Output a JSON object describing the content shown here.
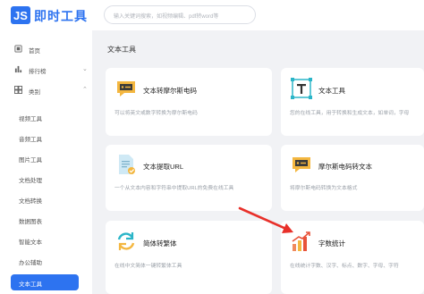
{
  "app": {
    "title": "即时工具"
  },
  "search": {
    "placeholder": "输入关键词搜索，如视频编辑、pdf转word等"
  },
  "sidebar": {
    "items": [
      {
        "label": "首页",
        "icon": "home-icon"
      },
      {
        "label": "排行榜",
        "icon": "ranking-icon"
      },
      {
        "label": "类别",
        "icon": "category-icon"
      },
      {
        "label": "视频工具"
      },
      {
        "label": "音频工具"
      },
      {
        "label": "图片工具"
      },
      {
        "label": "文档处理"
      },
      {
        "label": "文档转换"
      },
      {
        "label": "数据图表"
      },
      {
        "label": "智能文本"
      },
      {
        "label": "办公辅助"
      },
      {
        "label": "文本工具"
      }
    ]
  },
  "main": {
    "section_title": "文本工具",
    "cards": [
      {
        "title": "文本转摩尔斯电码",
        "desc": "可以将英文或数字转换为摩尔斯电码",
        "icon": "morse-chat-icon"
      },
      {
        "title": "文本工具",
        "desc": "您的在线工具，用于转换和生成文本，如单词，字母",
        "icon": "text-t-icon"
      },
      {
        "title": "文本提取URL",
        "desc": "一个从文本内容和字符串中提取URL的免费在线工具",
        "icon": "document-extract-icon"
      },
      {
        "title": "摩尔斯电码转文本",
        "desc": "将摩尔斯电码转换为文本格式",
        "icon": "morse-chat-icon"
      },
      {
        "title": "简体转繁体",
        "desc": "在线中文简体一键转繁体工具",
        "icon": "convert-refresh-icon"
      },
      {
        "title": "字数统计",
        "desc": "在线统计字数、汉字、标点、数字、字母、字符",
        "icon": "bar-chart-icon"
      }
    ]
  },
  "colors": {
    "accent": "#2d73f0",
    "arrow": "#e8302a"
  }
}
